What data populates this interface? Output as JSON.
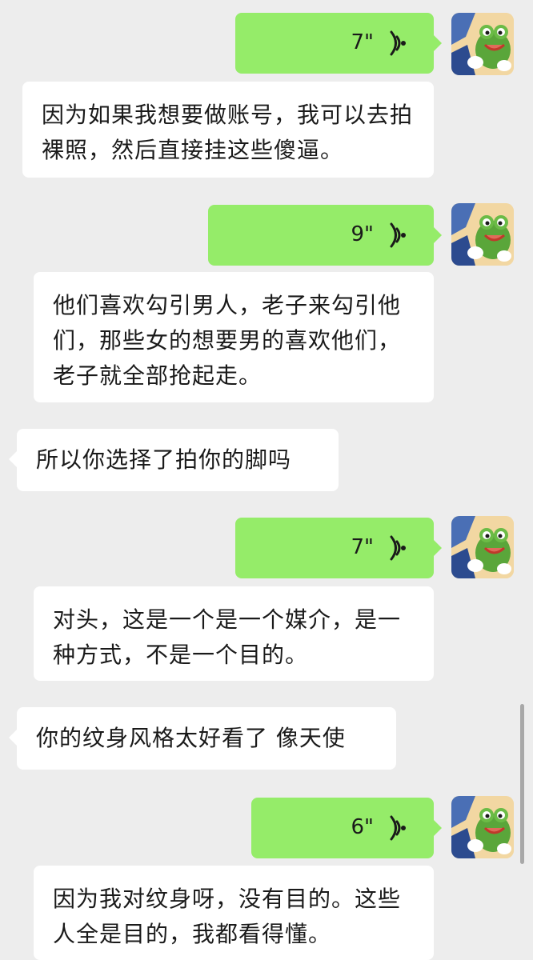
{
  "messages": [
    {
      "side": "right",
      "kind": "voice",
      "duration": "7\"",
      "transcript": "因为如果我想要做账号，我可以去拍裸照，然后直接挂这些傻逼。"
    },
    {
      "side": "right",
      "kind": "voice",
      "duration": "9\"",
      "transcript": "他们喜欢勾引男人，老子来勾引他们，那些女的想要男的喜欢他们，老子就全部抢起走。"
    },
    {
      "side": "left",
      "kind": "text",
      "text": "所以你选择了拍你的脚吗"
    },
    {
      "side": "right",
      "kind": "voice",
      "duration": "7\"",
      "transcript": "对头，这是一个是一个媒介，是一种方式，不是一个目的。"
    },
    {
      "side": "left",
      "kind": "text",
      "text": "你的纹身风格太好看了 像天使"
    },
    {
      "side": "right",
      "kind": "voice",
      "duration": "6\"",
      "transcript": "因为我对纹身呀，没有目的。这些人全是目的，我都看得懂。"
    }
  ],
  "colors": {
    "background": "#ededed",
    "outgoing_bubble": "#95ec69",
    "incoming_bubble": "#ffffff",
    "text": "#1a1a1a"
  },
  "icons": {
    "voice": "voice-wave-icon",
    "avatar": "frog-avatar"
  }
}
